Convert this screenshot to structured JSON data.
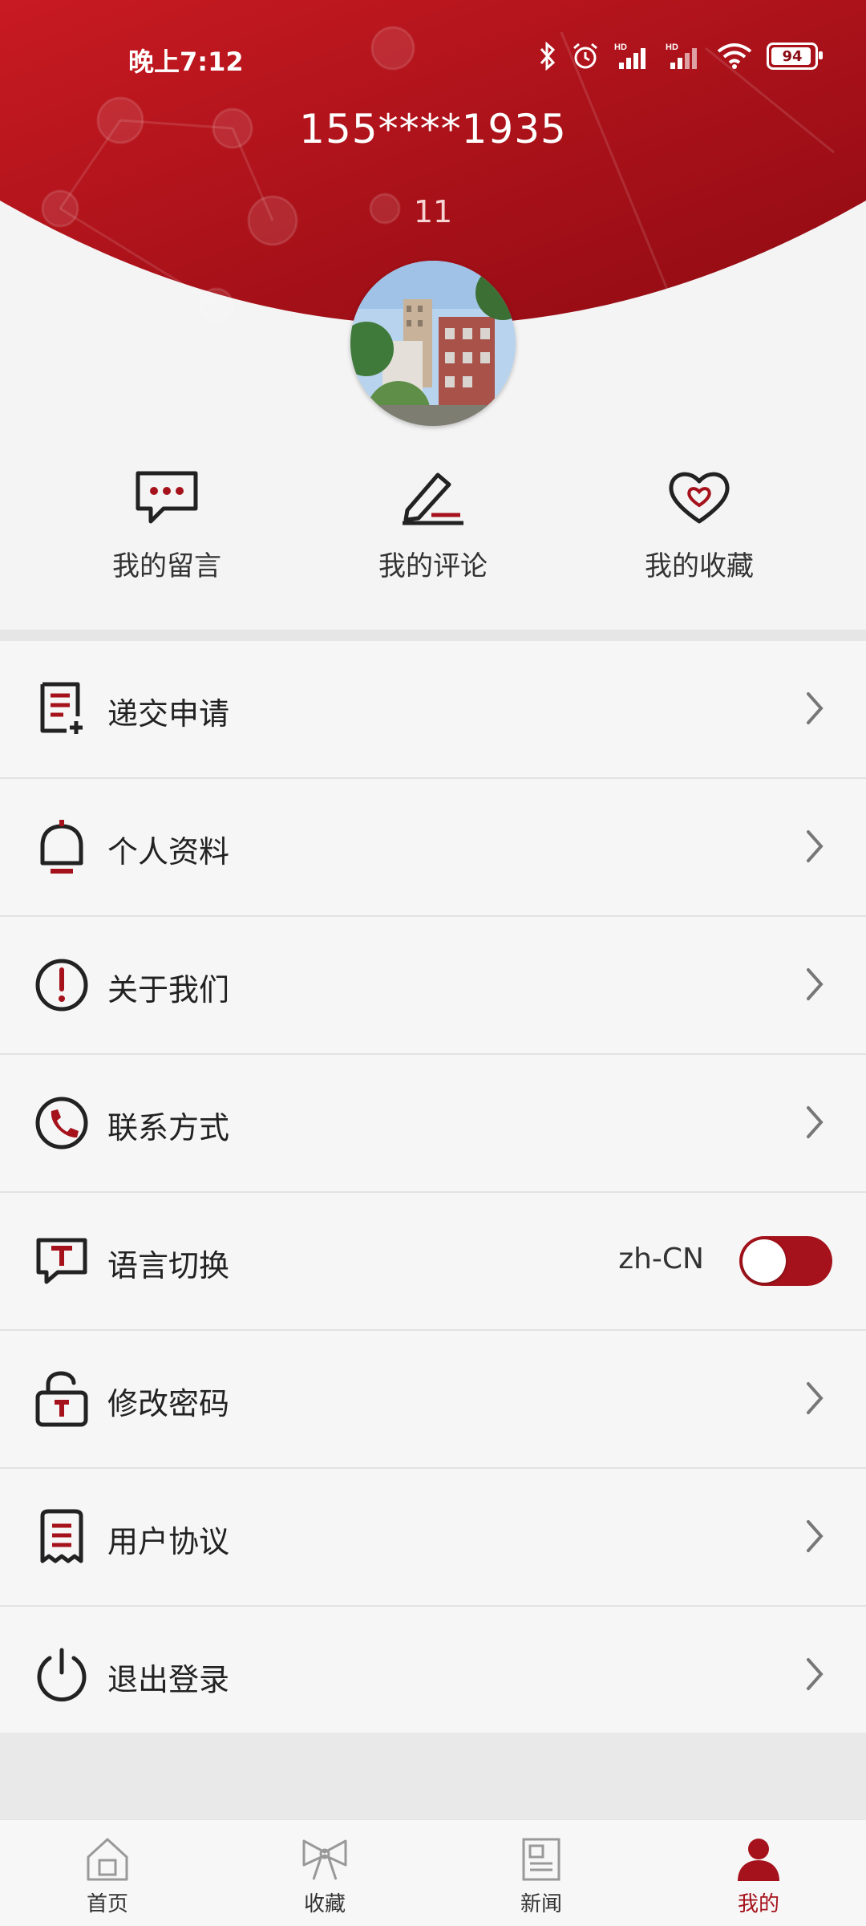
{
  "status_bar": {
    "time": "晚上7:12",
    "battery": "94"
  },
  "profile": {
    "phone": "155****1935",
    "points": "11"
  },
  "quick_actions": [
    {
      "icon": "chat-bubble-icon",
      "label": "我的留言"
    },
    {
      "icon": "pen-icon",
      "label": "我的评论"
    },
    {
      "icon": "heart-icon",
      "label": "我的收藏"
    }
  ],
  "menu": [
    {
      "icon": "document-plus-icon",
      "label": "递交申请"
    },
    {
      "icon": "bell-icon",
      "label": "个人资料"
    },
    {
      "icon": "exclamation-circle-icon",
      "label": "关于我们"
    },
    {
      "icon": "phone-icon",
      "label": "联系方式"
    },
    {
      "icon": "translate-icon",
      "label": "语言切换",
      "value": "zh-CN",
      "toggle_on": true
    },
    {
      "icon": "lock-icon",
      "label": "修改密码"
    },
    {
      "icon": "receipt-icon",
      "label": "用户协议"
    },
    {
      "icon": "power-icon",
      "label": "退出登录"
    }
  ],
  "tabbar": [
    {
      "icon": "home-icon",
      "label": "首页",
      "active": false
    },
    {
      "icon": "bow-icon",
      "label": "收藏",
      "active": false
    },
    {
      "icon": "newspaper-icon",
      "label": "新闻",
      "active": false
    },
    {
      "icon": "user-icon",
      "label": "我的",
      "active": true
    }
  ],
  "colors": {
    "brand": "#a5121b",
    "brand_dark": "#8a0a12"
  }
}
